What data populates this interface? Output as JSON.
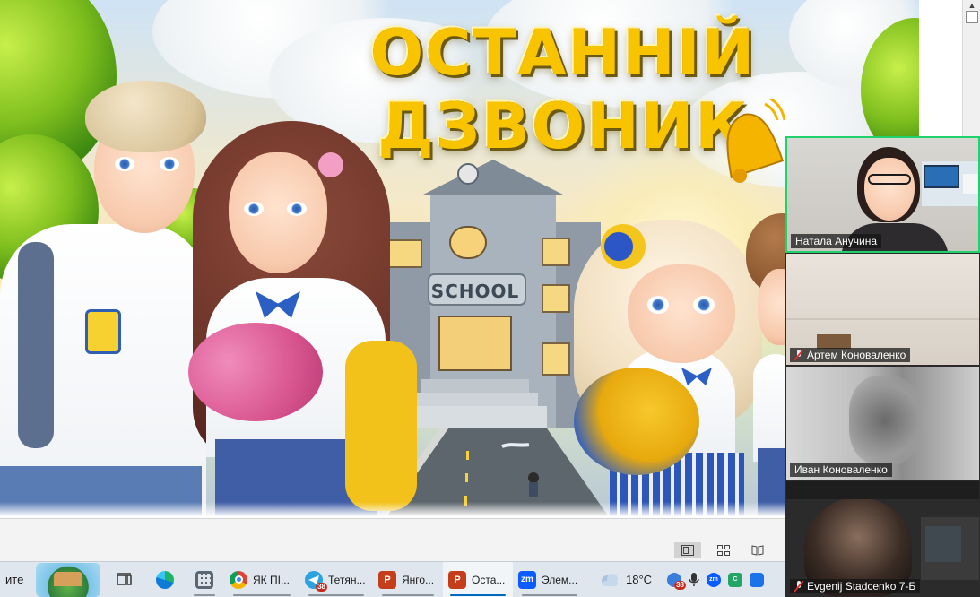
{
  "slide": {
    "title_line1": "ОСТАННІЙ",
    "title_line2": "ДЗВОНИК",
    "school_sign": "SCHOOL"
  },
  "video_panel": {
    "participants": [
      {
        "name": "Натала Анучина",
        "muted": false,
        "active_speaker": true
      },
      {
        "name": "Артем Коноваленко",
        "muted": true,
        "active_speaker": false
      },
      {
        "name": "Иван Коноваленко",
        "muted": false,
        "active_speaker": false
      },
      {
        "name": "Evgenij Stadcenko 7-Б",
        "muted": true,
        "active_speaker": false
      }
    ]
  },
  "taskbar": {
    "search_fragment": "ите",
    "apps": [
      {
        "label": "",
        "icon": "task-view-icon"
      },
      {
        "label": "",
        "icon": "edge-icon"
      },
      {
        "label": "",
        "icon": "calculator-icon"
      },
      {
        "label": "ЯК ПІ...",
        "icon": "chrome-icon"
      },
      {
        "label": "Тетян...",
        "icon": "telegram-icon",
        "badge": "38"
      },
      {
        "label": "Янго...",
        "icon": "powerpoint-icon"
      },
      {
        "label": "Оста...",
        "icon": "powerpoint-icon"
      },
      {
        "label": "Элем...",
        "icon": "zoom-icon"
      }
    ],
    "weather_temp": "18°C",
    "tray_badge": "38"
  },
  "colors": {
    "title_yellow": "#f8c400",
    "active_speaker": "#21d16c",
    "taskbar_bg": "#dfe6ee",
    "powerpoint": "#c43e1c",
    "zoom": "#0b5cff",
    "telegram": "#2aa3df"
  }
}
